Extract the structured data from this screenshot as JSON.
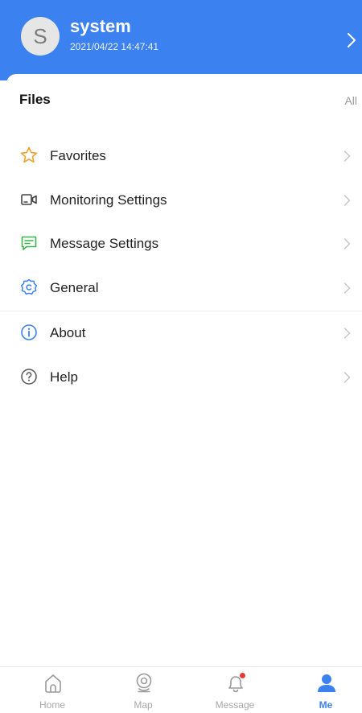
{
  "colors": {
    "accent": "#3b82f0",
    "favorites_icon": "#f0a030",
    "message_icon": "#39b54a",
    "notification_dot": "#e53935"
  },
  "profile": {
    "avatar_letter": "S",
    "username": "system",
    "timestamp": "2021/04/22 14:47:41"
  },
  "files": {
    "title": "Files",
    "all_label": "All"
  },
  "menu": [
    {
      "label": "Favorites",
      "icon": "star-icon"
    },
    {
      "label": "Monitoring Settings",
      "icon": "video-camera-icon"
    },
    {
      "label": "Message Settings",
      "icon": "message-icon"
    },
    {
      "label": "General",
      "icon": "general-settings-icon"
    },
    {
      "label": "About",
      "icon": "info-icon"
    },
    {
      "label": "Help",
      "icon": "help-icon"
    }
  ],
  "tabs": [
    {
      "label": "Home",
      "icon": "home-icon"
    },
    {
      "label": "Map",
      "icon": "map-pin-icon"
    },
    {
      "label": "Message",
      "icon": "bell-icon",
      "has_badge": true
    },
    {
      "label": "Me",
      "icon": "person-icon",
      "active": true
    }
  ]
}
